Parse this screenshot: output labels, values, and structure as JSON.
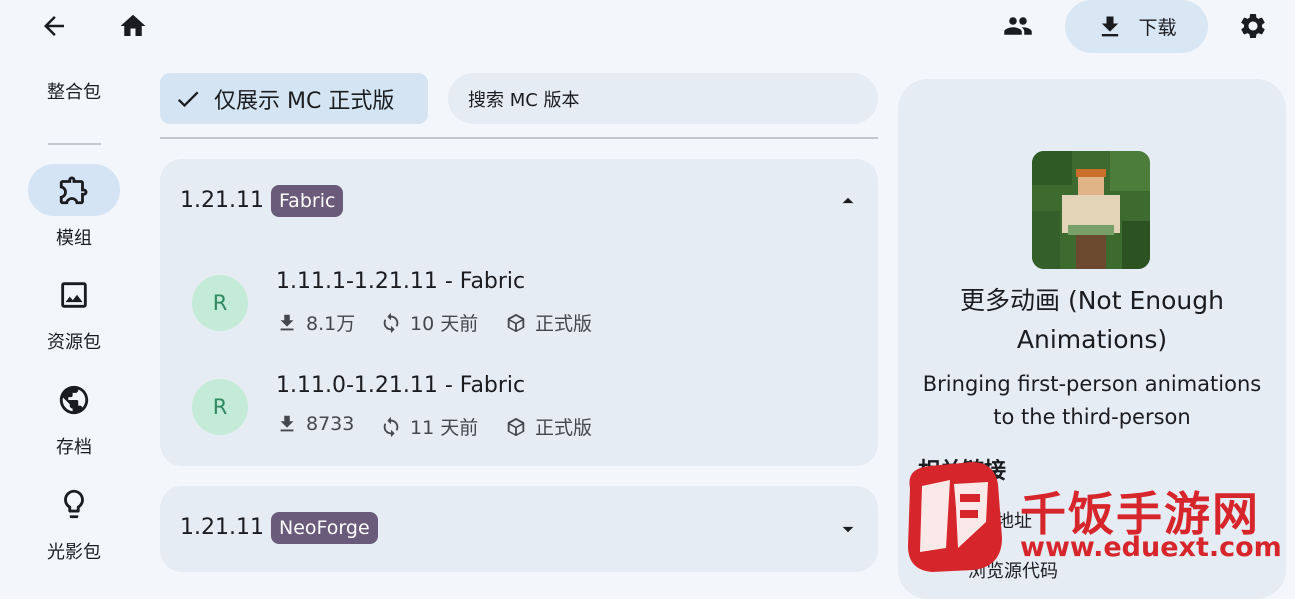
{
  "topbar": {
    "back_icon": "arrow-back-icon",
    "home_icon": "home-icon",
    "people_icon": "people-icon",
    "download_label": "下载",
    "settings_icon": "gear-icon"
  },
  "sidebar": {
    "items": [
      {
        "label": "整合包"
      },
      {
        "label": "模组",
        "icon": "puzzle-icon",
        "selected": true
      },
      {
        "label": "资源包",
        "icon": "image-icon"
      },
      {
        "label": "存档",
        "icon": "globe-icon"
      },
      {
        "label": "光影包",
        "icon": "lightbulb-icon"
      }
    ]
  },
  "filter": {
    "chip_label": "仅展示 MC 正式版",
    "chip_checked": true,
    "search_placeholder": "搜索 MC 版本"
  },
  "groups": [
    {
      "version": "1.21.11",
      "loader": "Fabric",
      "expanded": true,
      "files": [
        {
          "avatar": "R",
          "name": "1.11.1-1.21.11 - Fabric",
          "downloads": "8.1万",
          "updated": "10 天前",
          "type": "正式版"
        },
        {
          "avatar": "R",
          "name": "1.11.0-1.21.11 - Fabric",
          "downloads": "8733",
          "updated": "11 天前",
          "type": "正式版"
        }
      ]
    },
    {
      "version": "1.21.11",
      "loader": "NeoForge",
      "expanded": false
    }
  ],
  "detail": {
    "title": "更多动画 (Not Enough Animations)",
    "description": "Bringing first-person animations to the third-person",
    "links_heading": "相关链接",
    "links": [
      "项目地址",
      "浏览源代码"
    ]
  },
  "watermark": {
    "logo_char": "饭",
    "brand": "千饭手游网",
    "url": "www.eduext.com"
  },
  "colors": {
    "background": "#f3f6fb",
    "card": "#e6ecf3",
    "accent_chip": "#d4e4f2",
    "loader_tag": "#6a5b7b",
    "avatar_bg": "#c4ebd8",
    "watermark_red": "#d7262b"
  }
}
